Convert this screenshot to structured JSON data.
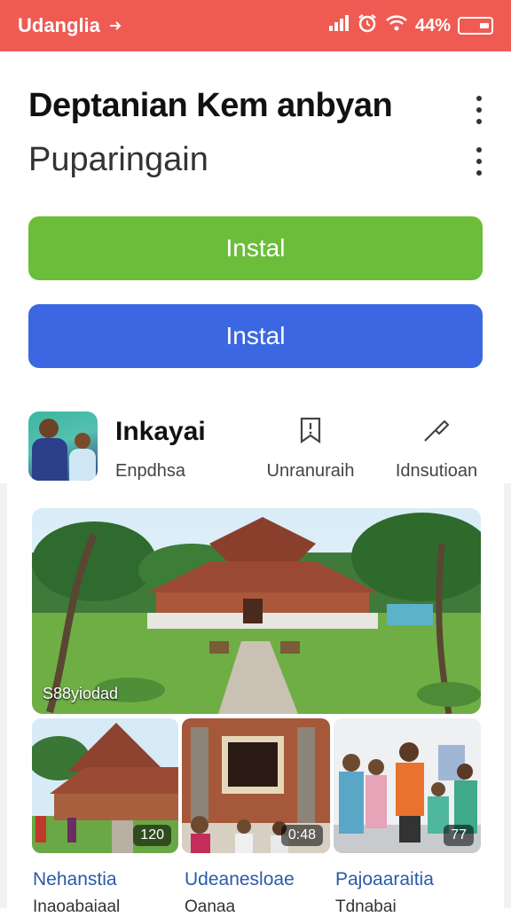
{
  "status_bar": {
    "label": "Udanglia",
    "battery_text": "44%"
  },
  "header": {
    "title": "Deptanian Kem anbyan",
    "subtitle": "Puparingain"
  },
  "buttons": {
    "primary_label": "Instal",
    "secondary_label": "Instal"
  },
  "app": {
    "name": "Inkayai",
    "developer": "Enpdhsa",
    "actions": [
      {
        "label": "Unranuraih",
        "icon": "bookmark-icon"
      },
      {
        "label": "Idnsutioan",
        "icon": "share-icon"
      }
    ]
  },
  "gallery": {
    "main_tag": "S88yiodad",
    "thumbs": [
      {
        "badge": "120",
        "title": "Nehanstia",
        "subtitle": "Inaoabaiaal"
      },
      {
        "badge": "0:48",
        "title": "Udeanesloae",
        "subtitle": "Oanaa"
      },
      {
        "badge": "77",
        "title": "Pajoaaraitia",
        "subtitle": "Tdnabai"
      }
    ]
  },
  "colors": {
    "status_bar": "#ef5b52",
    "primary_button": "#6cbd3a",
    "secondary_button": "#3b68e2",
    "caption": "#2a5aa8"
  }
}
